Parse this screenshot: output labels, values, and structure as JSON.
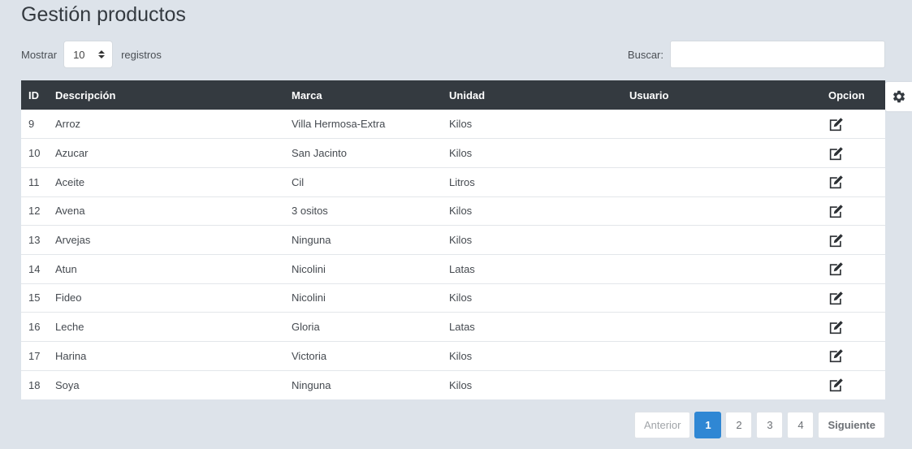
{
  "page": {
    "title": "Gestión productos"
  },
  "length": {
    "label_before": "Mostrar",
    "value": "10",
    "label_after": "registros"
  },
  "search": {
    "label": "Buscar:",
    "value": "",
    "placeholder": ""
  },
  "table": {
    "headers": {
      "id": "ID",
      "descripcion": "Descripción",
      "marca": "Marca",
      "unidad": "Unidad",
      "usuario": "Usuario",
      "opcion": "Opcion"
    },
    "rows": [
      {
        "id": "9",
        "descripcion": "Arroz",
        "marca": "Villa Hermosa-Extra",
        "unidad": "Kilos",
        "usuario": ""
      },
      {
        "id": "10",
        "descripcion": "Azucar",
        "marca": "San Jacinto",
        "unidad": "Kilos",
        "usuario": ""
      },
      {
        "id": "11",
        "descripcion": "Aceite",
        "marca": "Cil",
        "unidad": "Litros",
        "usuario": ""
      },
      {
        "id": "12",
        "descripcion": "Avena",
        "marca": "3 ositos",
        "unidad": "Kilos",
        "usuario": ""
      },
      {
        "id": "13",
        "descripcion": "Arvejas",
        "marca": "Ninguna",
        "unidad": "Kilos",
        "usuario": ""
      },
      {
        "id": "14",
        "descripcion": "Atun",
        "marca": "Nicolini",
        "unidad": "Latas",
        "usuario": ""
      },
      {
        "id": "15",
        "descripcion": "Fideo",
        "marca": "Nicolini",
        "unidad": "Kilos",
        "usuario": ""
      },
      {
        "id": "16",
        "descripcion": "Leche",
        "marca": "Gloria",
        "unidad": "Latas",
        "usuario": ""
      },
      {
        "id": "17",
        "descripcion": "Harina",
        "marca": "Victoria",
        "unidad": "Kilos",
        "usuario": ""
      },
      {
        "id": "18",
        "descripcion": "Soya",
        "marca": "Ninguna",
        "unidad": "Kilos",
        "usuario": ""
      }
    ],
    "row_action_icon": "edit-icon"
  },
  "settings": {
    "icon": "gear-icon"
  },
  "pagination": {
    "previous": "Anterior",
    "pages": [
      "1",
      "2",
      "3",
      "4"
    ],
    "current": "1",
    "next": "Siguiente"
  },
  "colors": {
    "header_bg": "#343a40",
    "active_page": "#2f87d4",
    "page_bg": "#dde3ea"
  }
}
